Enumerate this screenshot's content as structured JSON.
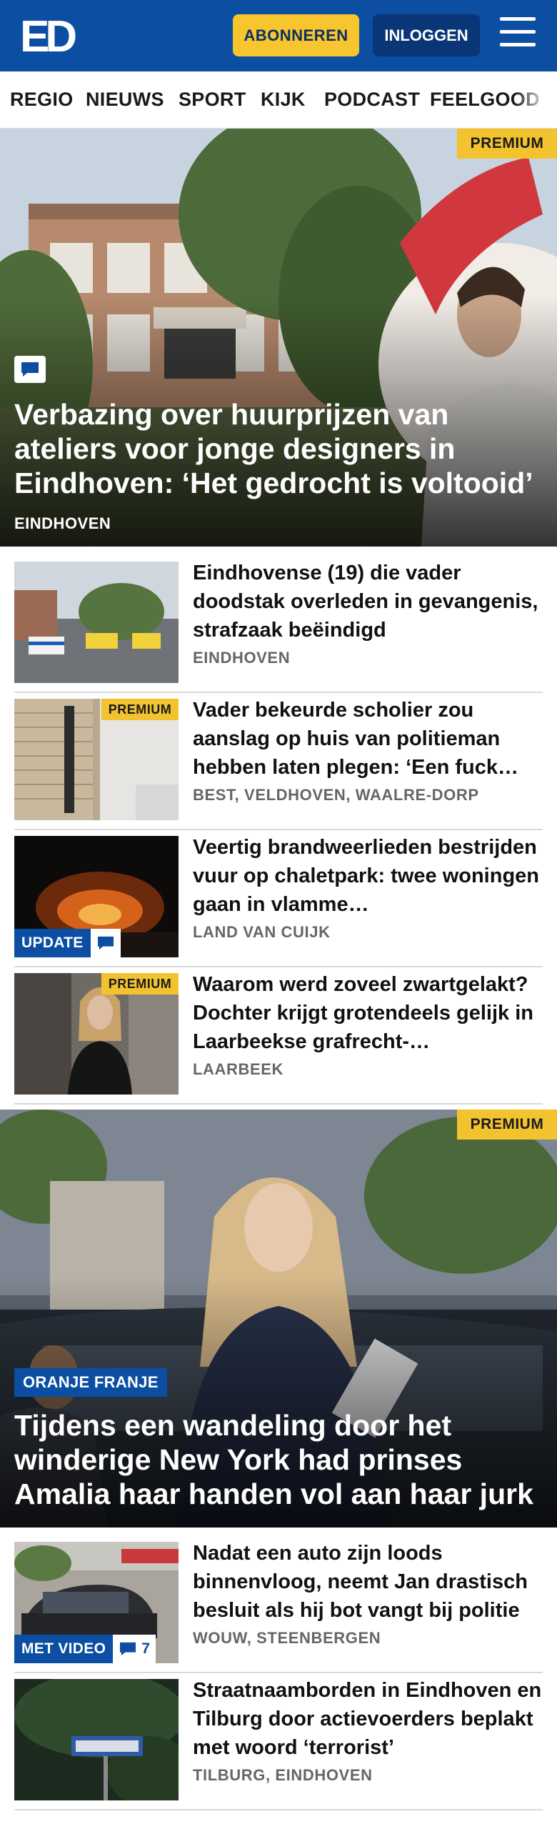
{
  "header": {
    "logo_text": "ED",
    "subscribe_label": "ABONNEREN",
    "login_label": "INLOGGEN"
  },
  "nav": {
    "items": [
      "REGIO",
      "NIEUWS",
      "SPORT",
      "KIJK",
      "PODCAST",
      "FEELGOOD"
    ]
  },
  "hero1": {
    "badge": "PREMIUM",
    "title": "Verbazing over huurprijzen van ateliers voor jonge designers in Eindhoven: ‘Het gedrocht is voltooid’",
    "location": "EINDHOVEN"
  },
  "articles1": [
    {
      "title": "Eindhovense (19) die vader doodstak overleden in gevangenis, strafzaak beëindigd",
      "location": "EINDHOVEN"
    },
    {
      "badge": "PREMIUM",
      "title": "Vader bekeurde scholier zou aanslag op huis van politieman hebben laten plegen: ‘Een fuck…",
      "location": "BEST, VELDHOVEN, WAALRE-DORP"
    },
    {
      "badge": "UPDATE",
      "title": "Veertig brandweerlieden bestrijden vuur op chaletpark: twee woningen gaan in vlamme…",
      "location": "LAND VAN CUIJK"
    },
    {
      "badge": "PREMIUM",
      "title": "Waarom werd zoveel zwartgelakt? Dochter krijgt grotendeels gelijk in Laarbeekse grafrecht-…",
      "location": "LAARBEEK"
    }
  ],
  "hero2": {
    "badge": "PREMIUM",
    "section": "ORANJE FRANJE",
    "title": "Tijdens een wandeling door het winderige New York had prinses Amalia haar handen vol aan haar jurk"
  },
  "articles2": [
    {
      "badge": "MET VIDEO",
      "comments": "7",
      "title": "Nadat een auto zijn loods binnenvloog, neemt Jan drastisch besluit als hij bot vangt bij politie",
      "location": "WOUW, STEENBERGEN"
    },
    {
      "title": "Straatnaamborden in Eindhoven en Tilburg door actievoerders beplakt met woord ‘terrorist’",
      "location": "TILBURG, EINDHOVEN"
    }
  ],
  "colors": {
    "brand_blue": "#0b4ea2",
    "premium_yellow": "#f3c32f",
    "subscribe_yellow": "#f7c52e"
  }
}
